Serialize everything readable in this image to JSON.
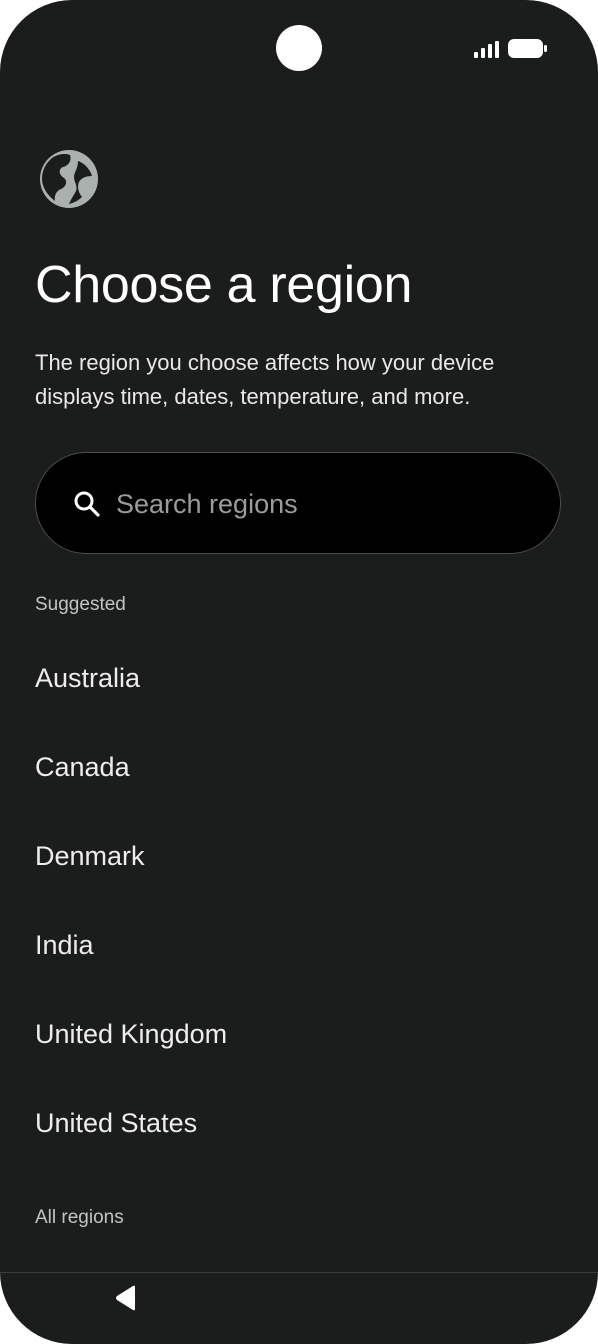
{
  "status_bar": {
    "signal_icon": "cellular-signal-icon",
    "battery_icon": "battery-icon"
  },
  "header": {
    "icon": "globe-icon",
    "title": "Choose a region",
    "description": "The region you choose affects how your device displays time, dates, temperature, and more."
  },
  "search": {
    "icon": "search-icon",
    "placeholder": "Search regions",
    "value": ""
  },
  "suggested": {
    "header": "Suggested",
    "items": [
      {
        "label": "Australia"
      },
      {
        "label": "Canada"
      },
      {
        "label": "Denmark"
      },
      {
        "label": "India"
      },
      {
        "label": "United Kingdom"
      },
      {
        "label": "United States"
      }
    ]
  },
  "all_regions": {
    "header": "All regions"
  },
  "nav_bar": {
    "back_icon": "back-triangle-icon"
  },
  "colors": {
    "background": "#1b1c1c",
    "globe": "#a9b0ad",
    "search_bg": "#000000",
    "text_primary": "#ffffff"
  }
}
